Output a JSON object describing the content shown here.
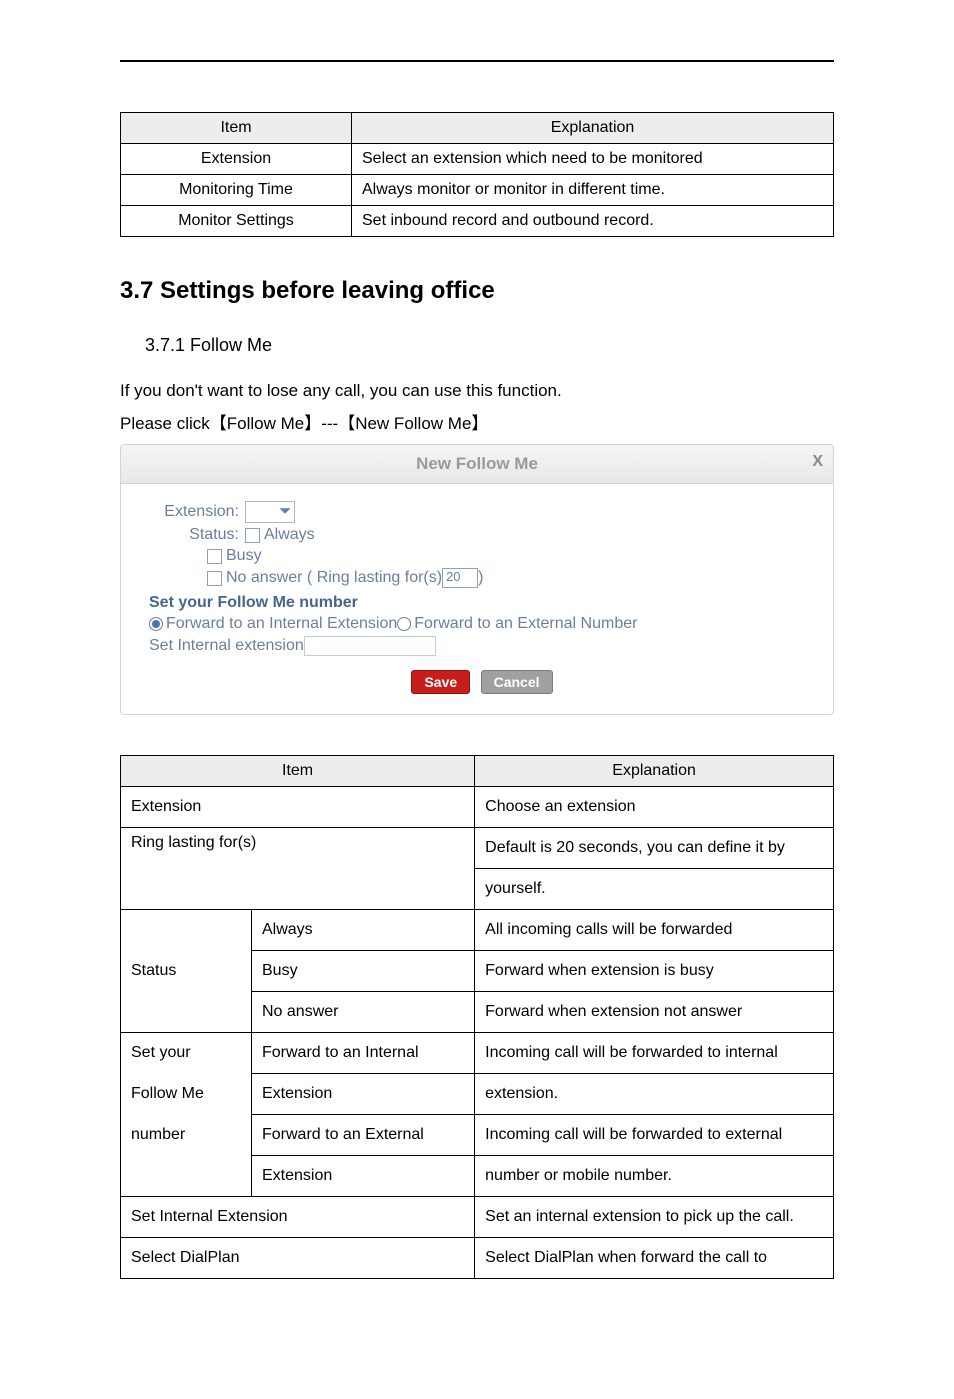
{
  "tbl1": {
    "head_item": "Item",
    "head_expl": "Explanation",
    "rows": [
      {
        "item": "Extension",
        "expl": "Select an extension which need to be monitored"
      },
      {
        "item": "Monitoring Time",
        "expl": "Always monitor or monitor in different time."
      },
      {
        "item": "Monitor Settings",
        "expl": "Set inbound record and outbound record."
      }
    ]
  },
  "section_title": "3.7 Settings before leaving office",
  "subsection_title": "3.7.1 Follow Me",
  "para1": "If you don't want to lose any call, you can use this function.",
  "para2": "Please click【Follow Me】---【New Follow Me】",
  "panel": {
    "title": "New Follow Me",
    "extension_label": "Extension:",
    "status_label": "Status:",
    "always": "Always",
    "busy": "Busy",
    "no_answer_pre": "No answer ( Ring lasting for(s) ",
    "no_answer_val": "20",
    "no_answer_post": " )",
    "heading": "Set your Follow Me number",
    "fwd_internal": "Forward to an Internal Extension ",
    "fwd_external": "Forward to an External Number",
    "set_internal": "Set Internal extension ",
    "save": "Save",
    "cancel": "Cancel"
  },
  "tbl2": {
    "head_item": "Item",
    "head_expl": "Explanation",
    "r_ext": {
      "item": "Extension",
      "expl": "Choose an extension"
    },
    "r_ring": {
      "item": "Ring lasting for(s)",
      "expl1": "Default is 20 seconds, you can define it by",
      "expl2": "yourself."
    },
    "status_label": "Status",
    "r_always": {
      "sub": "Always",
      "expl": "All incoming calls will be forwarded"
    },
    "r_busy": {
      "sub": "Busy",
      "expl": "Forward when extension is busy"
    },
    "r_noans": {
      "sub": "No answer",
      "expl": "Forward when extension not answer"
    },
    "setyour": "Set your",
    "followme": "Follow Me",
    "number": "number",
    "r_fint1": {
      "sub": "Forward to an Internal",
      "expl": "Incoming call will be forwarded to internal"
    },
    "r_fint2": {
      "sub": "Extension",
      "expl": "extension."
    },
    "r_fext1": {
      "sub": "Forward to an External",
      "expl": "Incoming call will be forwarded to external"
    },
    "r_fext2": {
      "sub": "Extension",
      "expl": "number or mobile number."
    },
    "r_sie": {
      "item": "Set Internal Extension",
      "expl": "Set an internal extension to pick up the call."
    },
    "r_sdp": {
      "item": "Select DialPlan",
      "expl": "Select DialPlan when forward the call to"
    }
  }
}
